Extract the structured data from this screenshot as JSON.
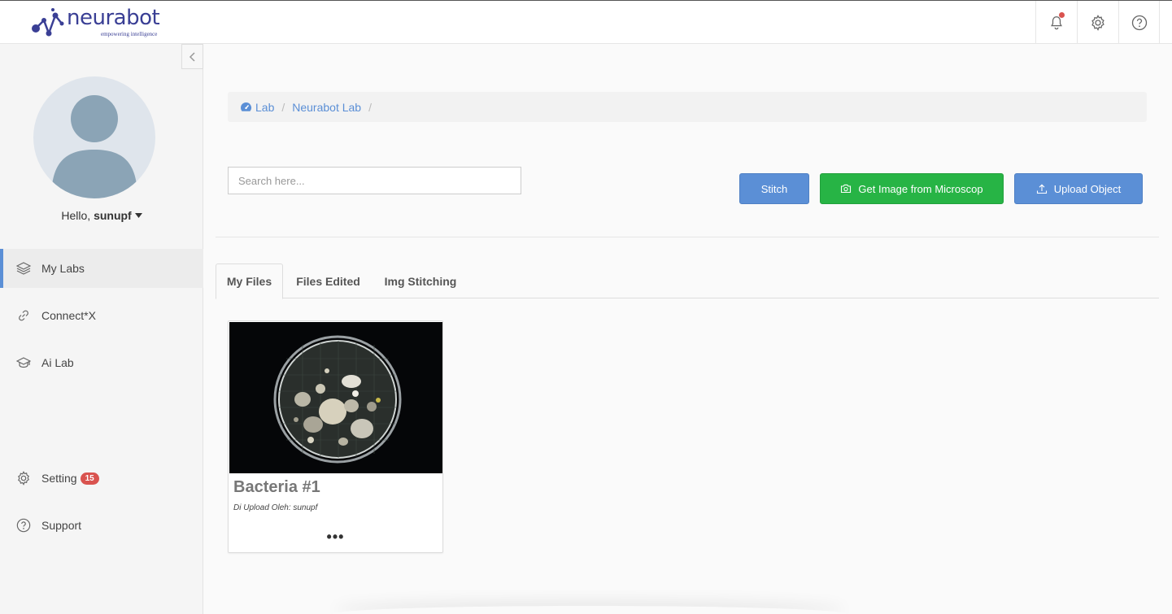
{
  "brand": {
    "name": "neurabot",
    "tagline": "empowering intelligence"
  },
  "user": {
    "greeting": "Hello,",
    "username": "sunupf"
  },
  "sidebar": {
    "items": [
      {
        "label": "My Labs",
        "icon": "layers-icon",
        "active": true
      },
      {
        "label": "Connect*X",
        "icon": "link-icon"
      },
      {
        "label": "Ai Lab",
        "icon": "graduation-cap-icon"
      }
    ],
    "bottom": [
      {
        "label": "Setting",
        "icon": "gear-icon",
        "badge": "15"
      },
      {
        "label": "Support",
        "icon": "question-circle-icon"
      }
    ]
  },
  "breadcrumb": [
    {
      "label": "Lab",
      "icon": "dashboard-icon"
    },
    {
      "label": "Neurabot Lab"
    }
  ],
  "search": {
    "placeholder": "Search here..."
  },
  "actions": {
    "stitch": "Stitch",
    "microscope": "Get Image from Microscop",
    "upload": "Upload Object"
  },
  "tabs": [
    {
      "label": "My Files",
      "active": true
    },
    {
      "label": "Files Edited"
    },
    {
      "label": "Img Stitching"
    }
  ],
  "files": [
    {
      "title": "Bacteria #1",
      "uploaded_by": "Di Upload Oleh: sunupf",
      "more": "•••"
    }
  ],
  "colors": {
    "primary": "#5b8fd6",
    "success": "#27b445",
    "brand": "#3a3f95",
    "badge": "#d9534f"
  }
}
